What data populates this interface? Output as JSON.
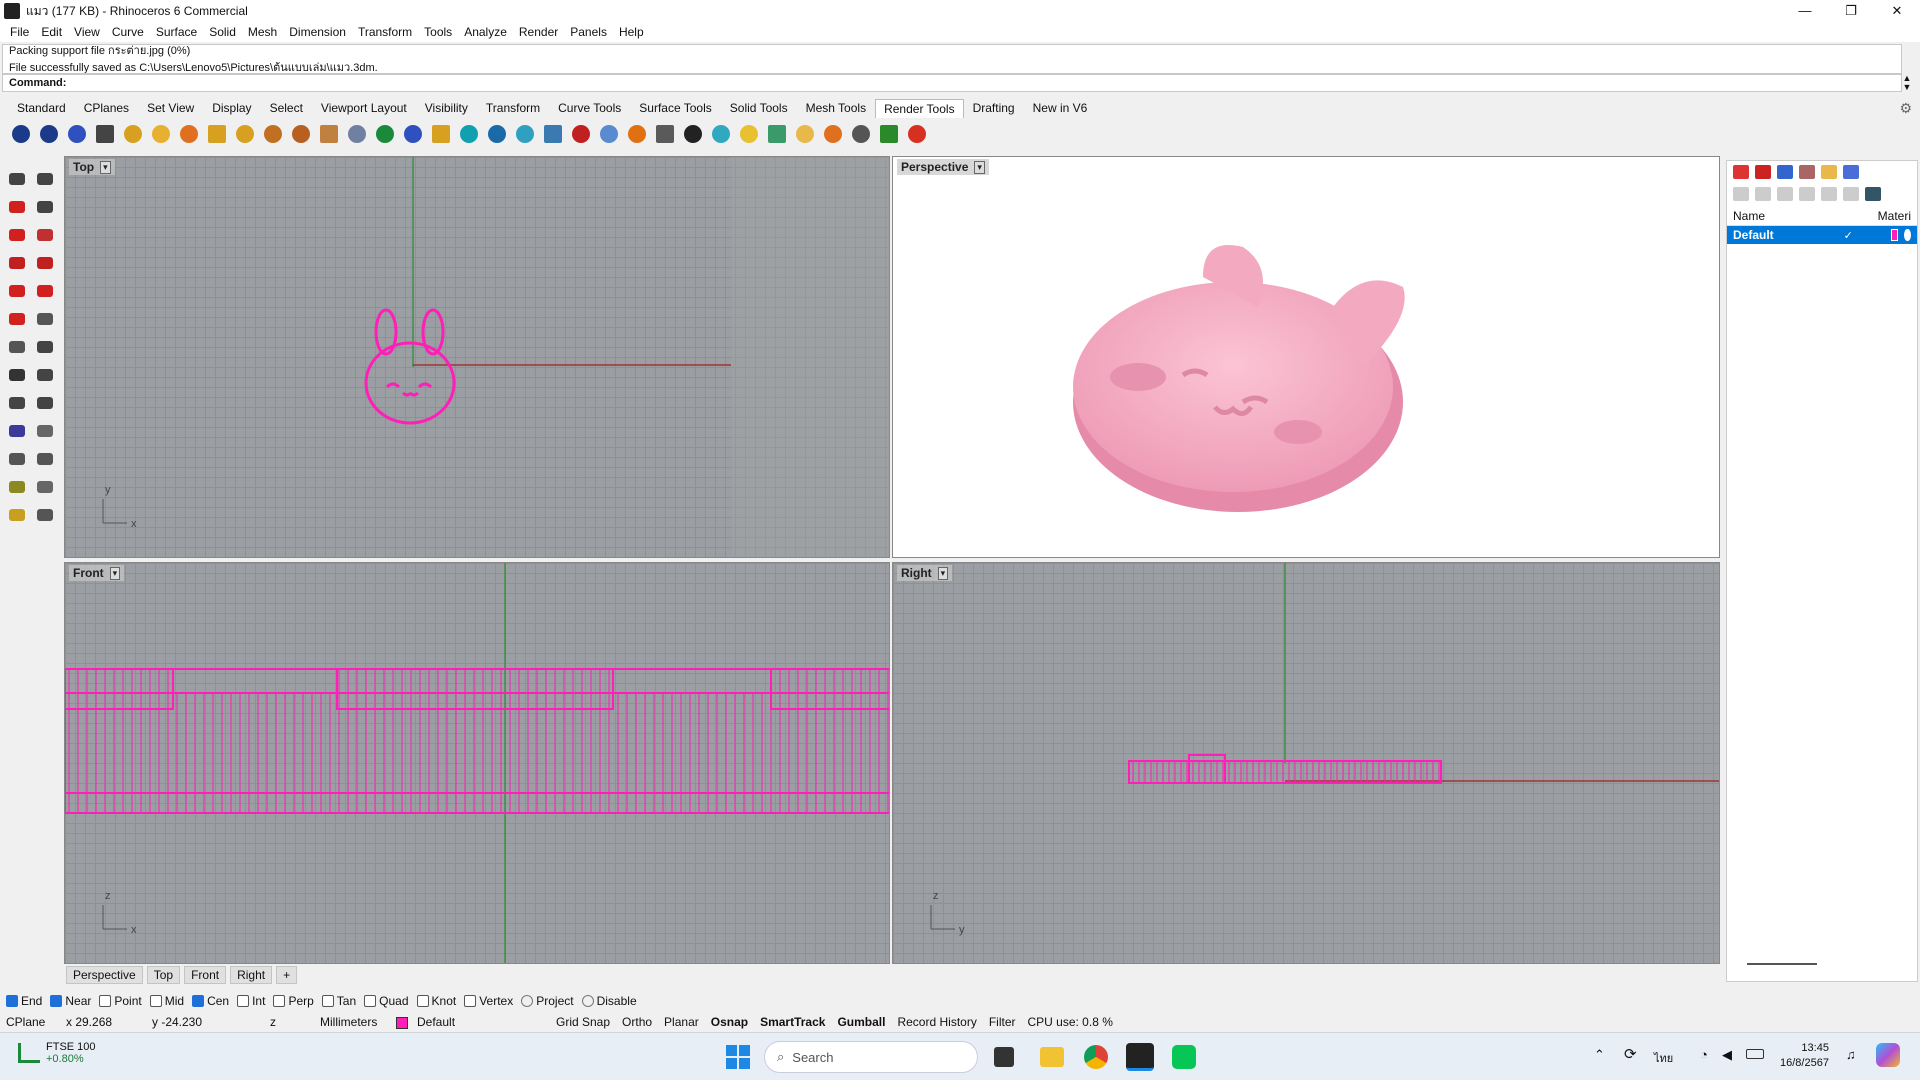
{
  "window": {
    "title": "แมว (177 KB) - Rhinoceros 6 Commercial",
    "buttons": [
      "—",
      "❐",
      "✕"
    ]
  },
  "menu": [
    "File",
    "Edit",
    "View",
    "Curve",
    "Surface",
    "Solid",
    "Mesh",
    "Dimension",
    "Transform",
    "Tools",
    "Analyze",
    "Render",
    "Panels",
    "Help"
  ],
  "history": {
    "line1": "Packing support file กระต่าย.jpg (0%)",
    "line2": "File successfully saved as C:\\Users\\Lenovo5\\Pictures\\ต้นแบบเล่ม\\แมว.3dm."
  },
  "command": {
    "label": "Command:",
    "value": ""
  },
  "tabs": [
    "Standard",
    "CPlanes",
    "Set View",
    "Display",
    "Select",
    "Viewport Layout",
    "Visibility",
    "Transform",
    "Curve Tools",
    "Surface Tools",
    "Solid Tools",
    "Mesh Tools",
    "Render Tools",
    "Drafting",
    "New in V6"
  ],
  "active_tab": "Render Tools",
  "toolbar_icons": [
    "render-sphere-icon",
    "render-sphere-icon",
    "render-color-sphere-icon",
    "materials-icon",
    "spotlight-icon",
    "point-light-icon",
    "directional-light-icon",
    "rectangular-light-icon",
    "linear-light-icon",
    "light-array-icon",
    "sun-icon",
    "edit-light-icon",
    "light-properties-icon",
    "environment-icon",
    "texture-icon",
    "decal-icon",
    "ground-plane-icon",
    "sky-icon",
    "box-mapping-icon",
    "cylinder-mapping-icon",
    "film-icon",
    "sphere-mapping-icon",
    "basketball-icon",
    "eyedropper-icon",
    "checker-icon",
    "ellipse-icon",
    "magnifier-icon",
    "keyboard-icon",
    "folder-icon",
    "gear-sparkle-icon",
    "monitor-icon",
    "play-render-icon",
    "record-icon"
  ],
  "viewports": {
    "top": "Top",
    "perspective": "Perspective",
    "front": "Front",
    "right": "Right"
  },
  "axis_labels": {
    "top_y": "y",
    "top_x": "x",
    "front_z": "z",
    "front_x": "x",
    "right_z": "z",
    "right_y": "y"
  },
  "viewport_tabs": [
    "Perspective",
    "Top",
    "Front",
    "Right",
    "+"
  ],
  "layers_panel": {
    "header_name": "Name",
    "header_material": "Materi",
    "row_name": "Default",
    "row_check": "✓"
  },
  "osnaps": [
    {
      "label": "End",
      "on": true
    },
    {
      "label": "Near",
      "on": true
    },
    {
      "label": "Point",
      "on": false
    },
    {
      "label": "Mid",
      "on": false
    },
    {
      "label": "Cen",
      "on": true
    },
    {
      "label": "Int",
      "on": false
    },
    {
      "label": "Perp",
      "on": false
    },
    {
      "label": "Tan",
      "on": false
    },
    {
      "label": "Quad",
      "on": false
    },
    {
      "label": "Knot",
      "on": false
    },
    {
      "label": "Vertex",
      "on": false
    }
  ],
  "osnap_extra": {
    "project": "Project",
    "disable": "Disable"
  },
  "status": {
    "cplane": "CPlane",
    "x": "x 29.268",
    "y": "y -24.230",
    "z": "z",
    "units": "Millimeters",
    "layer": "Default",
    "grid_snap": "Grid Snap",
    "ortho": "Ortho",
    "planar": "Planar",
    "osnap": "Osnap",
    "smarttrack": "SmartTrack",
    "gumball": "Gumball",
    "record_history": "Record History",
    "filter": "Filter",
    "cpu": "CPU use: 0.8 %"
  },
  "taskbar": {
    "stock_name": "FTSE 100",
    "stock_change": "+0.80%",
    "search": "Search",
    "lang": "ไทย",
    "time": "13:45",
    "date": "16/8/2567"
  },
  "colors": {
    "accent": "#0078d7",
    "curve_magenta": "#ff1fb8",
    "model_pink": "#f6a8c0",
    "viewport_gray": "#9b9ea2"
  }
}
